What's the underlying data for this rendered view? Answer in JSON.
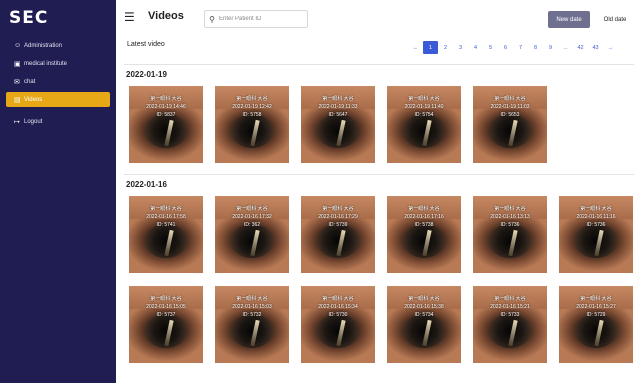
{
  "sidebar": {
    "logo": "SEC",
    "items": [
      {
        "label": "Administration",
        "icon": "user-icon",
        "glyph": "☺"
      },
      {
        "label": "medical institute",
        "icon": "building-icon",
        "glyph": "▣"
      },
      {
        "label": "chat",
        "icon": "chat-icon",
        "glyph": "✉"
      },
      {
        "label": "Videos",
        "icon": "folder-icon",
        "glyph": "▤"
      },
      {
        "label": "Logout",
        "icon": "logout-icon",
        "glyph": "↦"
      }
    ],
    "active_color": "#e6a816",
    "background": "#1f1d52"
  },
  "header": {
    "title": "Videos",
    "search_placeholder": "Enter Patient ID",
    "new_date_label": "New date",
    "old_date_label": "Old date"
  },
  "subheader": {
    "latest_label": "Latest video",
    "pagination": [
      "←",
      "1",
      "2",
      "3",
      "4",
      "5",
      "6",
      "7",
      "8",
      "9",
      "...",
      "42",
      "43",
      "→"
    ],
    "active_page": "1"
  },
  "groups": [
    {
      "date": "2022-01-19",
      "videos": [
        {
          "name": "第一眼科 大谷",
          "time": "2022-01-19 14:46",
          "id": "ID: 5837"
        },
        {
          "name": "第一眼科 大谷",
          "time": "2022-01-19 12:42",
          "id": "ID: 5758"
        },
        {
          "name": "第一眼科 大谷",
          "time": "2022-01-19 11:33",
          "id": "ID: 5647"
        },
        {
          "name": "第一眼科 大谷",
          "time": "2022-01-19 11:40",
          "id": "ID: 5754"
        },
        {
          "name": "第一眼科 大谷",
          "time": "2022-01-19 11:03",
          "id": "ID: 5653"
        }
      ]
    },
    {
      "date": "2022-01-16",
      "videos": [
        {
          "name": "第一眼科 大谷",
          "time": "2022-01-16 17:58",
          "id": "ID: 5741"
        },
        {
          "name": "第一眼科 大谷",
          "time": "2022-01-16 17:32",
          "id": "ID: 362"
        },
        {
          "name": "第一眼科 大谷",
          "time": "2022-01-16 17:29",
          "id": "ID: 5739"
        },
        {
          "name": "第一眼科 大谷",
          "time": "2022-01-16 17:16",
          "id": "ID: 5738"
        },
        {
          "name": "第一眼科 大谷",
          "time": "2022-01-16 13:13",
          "id": "ID: 5736"
        },
        {
          "name": "第一眼科 大谷",
          "time": "2022-01-16 11:16",
          "id": "ID: 5736"
        },
        {
          "name": "第一眼科 大谷",
          "time": "2022-01-16 15:05",
          "id": "ID: 5737"
        },
        {
          "name": "第一眼科 大谷",
          "time": "2022-01-16 15:03",
          "id": "ID: 5732"
        },
        {
          "name": "第一眼科 大谷",
          "time": "2022-01-16 15:34",
          "id": "ID: 5730"
        },
        {
          "name": "第一眼科 大谷",
          "time": "2022-01-16 15:38",
          "id": "ID: 5734"
        },
        {
          "name": "第一眼科 大谷",
          "time": "2022-01-16 15:21",
          "id": "ID: 5733"
        },
        {
          "name": "第一眼科 大谷",
          "time": "2022-01-16 15:27",
          "id": "ID: 5729"
        }
      ]
    }
  ]
}
